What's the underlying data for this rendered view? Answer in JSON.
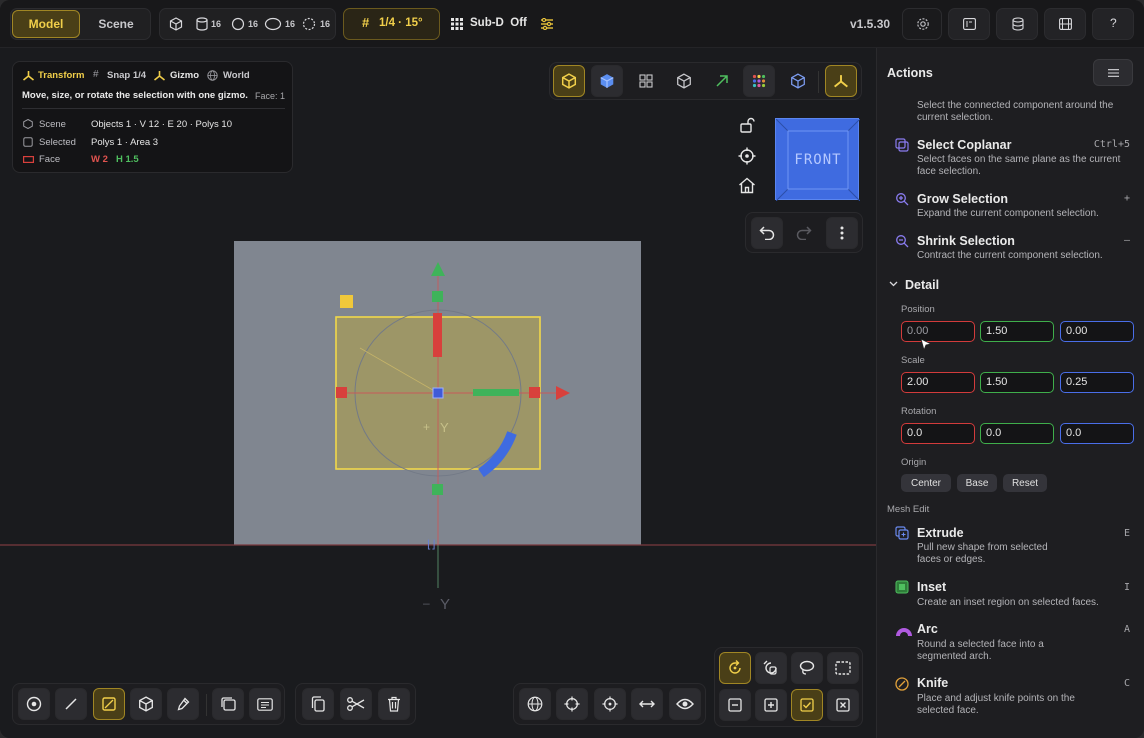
{
  "topbar": {
    "mode_model": "Model",
    "mode_scene": "Scene",
    "counts": [
      "16",
      "16",
      "16",
      "16"
    ],
    "snap_label": "1/4 · 15°",
    "subd_label": "Sub-D  Off",
    "version": "v1.5.30"
  },
  "info": {
    "tabs": [
      "Transform",
      "Snap 1/4",
      "Gizmo",
      "World"
    ],
    "hint": "Move, size, or rotate the selection with one gizmo.",
    "face": "Face: 1",
    "rows": [
      {
        "label": "Scene",
        "value": "Objects 1 · V 12 · E 20 · Polys 10"
      },
      {
        "label": "Selected",
        "value": "Polys 1 · Area 3"
      },
      {
        "label": "Face",
        "w": "W 2",
        "h": "H 1.5"
      }
    ]
  },
  "viewcube": {
    "label": "FRONT"
  },
  "viewport": {
    "axis_y": "Y",
    "axis_y_bottom": "Y"
  },
  "sidebar": {
    "title": "Actions",
    "truncated_desc": "Select the connected component around the current selection.",
    "actions": [
      {
        "title": "Select Coplanar",
        "key": "Ctrl+5",
        "desc": "Select faces on the same plane as the current face selection."
      },
      {
        "title": "Grow Selection",
        "key": "+",
        "desc": "Expand the current component selection."
      },
      {
        "title": "Shrink Selection",
        "key": "–",
        "desc": "Contract the current component selection."
      }
    ],
    "detail": {
      "title": "Detail",
      "position_label": "Position",
      "position": [
        "0.00",
        "1.50",
        "0.00"
      ],
      "scale_label": "Scale",
      "scale": [
        "2.00",
        "1.50",
        "0.25"
      ],
      "rotation_label": "Rotation",
      "rotation": [
        "0.0",
        "0.0",
        "0.0"
      ],
      "origin_label": "Origin",
      "origin_buttons": [
        "Center",
        "Base",
        "Reset"
      ]
    },
    "mesh_edit_label": "Mesh Edit",
    "mesh_actions": [
      {
        "title": "Extrude",
        "key": "E",
        "desc": "Pull new shape from selected faces or edges."
      },
      {
        "title": "Inset",
        "key": "I",
        "desc": "Create an inset region on selected faces."
      },
      {
        "title": "Arc",
        "key": "A",
        "desc": "Round a selected face into a segmented arch."
      },
      {
        "title": "Knife",
        "key": "C",
        "desc": "Place and adjust knife points on the selected face."
      }
    ]
  },
  "colors": {
    "accent": "#e8c23a",
    "x_axis": "#d23b3b",
    "y_axis": "#3fae4b",
    "z_axis": "#4a6ee8"
  }
}
